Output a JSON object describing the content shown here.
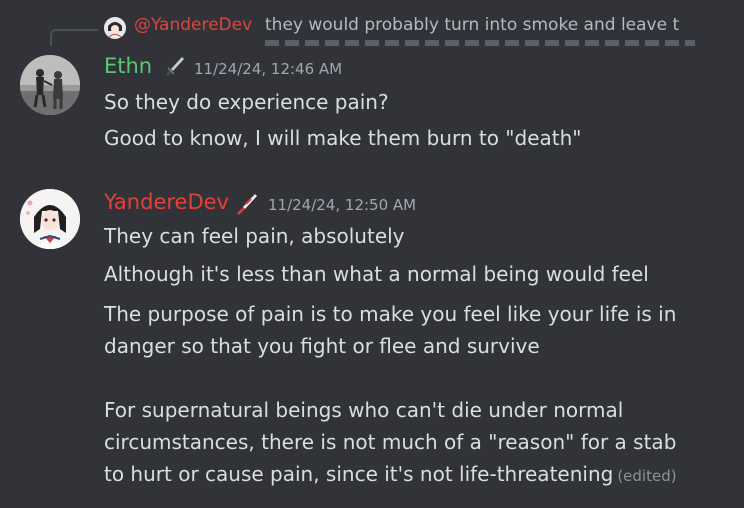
{
  "reply": {
    "author": "@YandereDev",
    "text": "they would probably turn into smoke and leave t"
  },
  "messages": [
    {
      "author": "Ethn",
      "timestamp": "11/24/24, 12:46 AM",
      "lines": [
        "So they do experience pain?",
        "Good to know, I will make them burn to \"death\""
      ]
    },
    {
      "author": "YandereDev",
      "timestamp": "11/24/24, 12:50 AM",
      "lines": [
        "They can feel pain, absolutely",
        "Although it's less than what a normal being would feel",
        "The purpose of pain is to make you feel like your life is in",
        "danger so that you fight or flee and survive",
        "For supernatural beings who can't die under normal",
        "circumstances, there is not much of a \"reason\" for a stab",
        "to hurt or cause pain, since it's not life-threatening"
      ],
      "edited_label": "(edited)"
    }
  ],
  "colors": {
    "background": "#313338",
    "ethn_name": "#5cc677",
    "yandere_name": "#e34139",
    "text": "#dbdee1",
    "muted": "#a3a6ad"
  }
}
